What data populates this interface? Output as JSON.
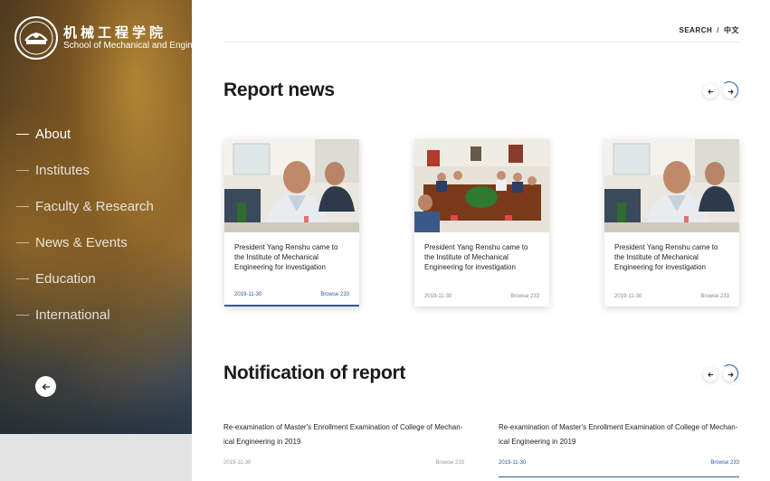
{
  "brand": {
    "name_cn": "机械工程学院",
    "name_en": "School of Mechanical and Engineering"
  },
  "sidebar": {
    "items": [
      {
        "label": "About",
        "active": true
      },
      {
        "label": "Institutes"
      },
      {
        "label": "Faculty & Research"
      },
      {
        "label": "News & Events"
      },
      {
        "label": "Education"
      },
      {
        "label": "International"
      }
    ]
  },
  "topbar": {
    "search_label": "SEARCH",
    "separator": "/",
    "lang_label": "中文"
  },
  "report_news": {
    "title": "Report news",
    "cards": [
      {
        "title": "President Yang Renshu came to the Institute of Mechanical Engineering for investigation",
        "date": "2019-11-30",
        "views": "Browse 233",
        "active": true
      },
      {
        "title": "President Yang Renshu came to the Institute of Mechanical Engineering for investigation",
        "date": "2019-11-30",
        "views": "Browse 233"
      },
      {
        "title": "President Yang Renshu came to the Institute of Mechanical Engineering for investigation",
        "date": "2019-11-30",
        "views": "Browse 233"
      }
    ]
  },
  "notifications": {
    "title": "Notification of report",
    "items": [
      {
        "title": "Re-examination of Master's Enrollment Examination of College of Mechan-ical Engineering in 2019",
        "date": "2019-11-30",
        "views": "Browse 233"
      },
      {
        "title": "Re-examination of Master's Enrollment Examination of College of Mechan-ical Engineering in 2019",
        "date": "2019-11-30",
        "views": "Browse 233",
        "active": true
      }
    ]
  },
  "colors": {
    "accent": "#2d5a9c",
    "text": "#1a1a1a",
    "sidebar_footer": "#e3e3e3"
  },
  "icons": {
    "prev": "arrow-left-icon",
    "next": "arrow-right-icon",
    "back": "arrow-left-icon"
  }
}
